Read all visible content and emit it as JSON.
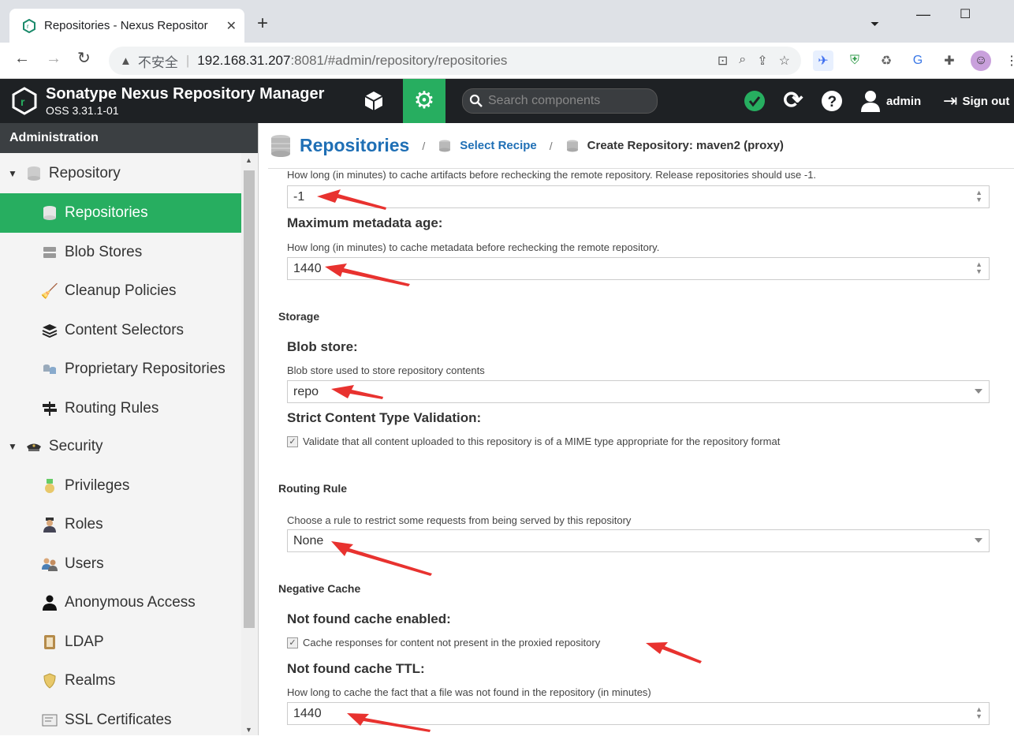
{
  "browser": {
    "tab_title": "Repositories - Nexus Repositor",
    "insecure_label": "不安全",
    "url_host": "192.168.31.207",
    "url_rest": ":8081/#admin/repository/repositories"
  },
  "header": {
    "app_title": "Sonatype Nexus Repository Manager",
    "version": "OSS 3.31.1-01",
    "search_placeholder": "Search components",
    "user": "admin",
    "sign_out": "Sign out"
  },
  "sidebar": {
    "heading": "Administration",
    "groups": [
      {
        "label": "Repository"
      },
      {
        "label": "Security"
      }
    ],
    "items": [
      {
        "label": "Repositories"
      },
      {
        "label": "Blob Stores"
      },
      {
        "label": "Cleanup Policies"
      },
      {
        "label": "Content Selectors"
      },
      {
        "label": "Proprietary Repositories"
      },
      {
        "label": "Routing Rules"
      },
      {
        "label": "Privileges"
      },
      {
        "label": "Roles"
      },
      {
        "label": "Users"
      },
      {
        "label": "Anonymous Access"
      },
      {
        "label": "LDAP"
      },
      {
        "label": "Realms"
      },
      {
        "label": "SSL Certificates"
      }
    ]
  },
  "breadcrumb": {
    "root": "Repositories",
    "step1": "Select Recipe",
    "current": "Create Repository: maven2 (proxy)"
  },
  "form": {
    "max_component_age_help": "How long (in minutes) to cache artifacts before rechecking the remote repository. Release repositories should use -1.",
    "max_component_age_value": "-1",
    "max_metadata_age_label": "Maximum metadata age:",
    "max_metadata_age_help": "How long (in minutes) to cache metadata before rechecking the remote repository.",
    "max_metadata_age_value": "1440",
    "storage_section": "Storage",
    "blob_store_label": "Blob store:",
    "blob_store_help": "Blob store used to store repository contents",
    "blob_store_value": "repo",
    "strict_validation_label": "Strict Content Type Validation:",
    "strict_validation_check": "Validate that all content uploaded to this repository is of a MIME type appropriate for the repository format",
    "routing_section": "Routing Rule",
    "routing_help": "Choose a rule to restrict some requests from being served by this repository",
    "routing_value": "None",
    "negative_cache_section": "Negative Cache",
    "nf_enabled_label": "Not found cache enabled:",
    "nf_enabled_check": "Cache responses for content not present in the proxied repository",
    "nf_ttl_label": "Not found cache TTL:",
    "nf_ttl_help": "How long to cache the fact that a file was not found in the repository (in minutes)",
    "nf_ttl_value": "1440"
  },
  "colors": {
    "accent_green": "#27ae60",
    "header_dark": "#1e2124",
    "link_blue": "#1f6fb5",
    "annotation_red": "#e8322f"
  }
}
